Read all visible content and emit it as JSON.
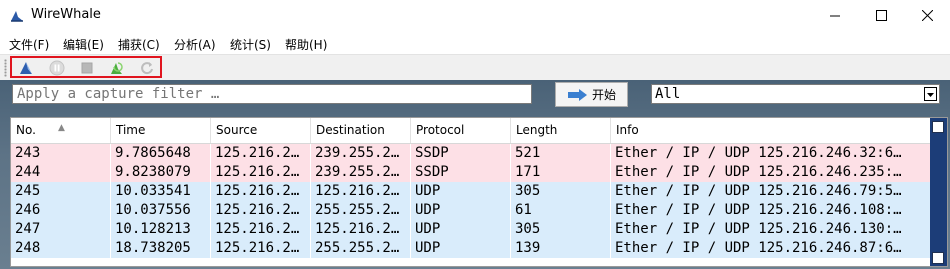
{
  "window": {
    "title": "WireWhale"
  },
  "menu": [
    "文件(F)",
    "编辑(E)",
    "捕获(C)",
    "分析(A)",
    "统计(S)",
    "帮助(H)"
  ],
  "filter": {
    "placeholder": "Apply a capture filter …"
  },
  "start_button": {
    "label": "开始"
  },
  "protocol_select": {
    "value": "All"
  },
  "table": {
    "columns": [
      "No.",
      "Time",
      "Source",
      "Destination",
      "Protocol",
      "Length",
      "Info"
    ],
    "rows": [
      {
        "no": "243",
        "time": "9.7865648",
        "source": "125.216.2…",
        "destination": "239.255.2…",
        "protocol": "SSDP",
        "length": "521",
        "info": "Ether / IP / UDP 125.216.246.32:6…",
        "bg": "#fde0e6"
      },
      {
        "no": "244",
        "time": "9.8238079",
        "source": "125.216.2…",
        "destination": "239.255.2…",
        "protocol": "SSDP",
        "length": "171",
        "info": "Ether / IP / UDP 125.216.246.235:…",
        "bg": "#fde0e6"
      },
      {
        "no": "245",
        "time": "10.033541",
        "source": "125.216.2…",
        "destination": "125.216.2…",
        "protocol": "UDP",
        "length": "305",
        "info": "Ether / IP / UDP 125.216.246.79:5…",
        "bg": "#d9ecfb"
      },
      {
        "no": "246",
        "time": "10.037556",
        "source": "125.216.2…",
        "destination": "255.255.2…",
        "protocol": "UDP",
        "length": "61",
        "info": "Ether / IP / UDP 125.216.246.108:…",
        "bg": "#d9ecfb"
      },
      {
        "no": "247",
        "time": "10.128213",
        "source": "125.216.2…",
        "destination": "125.216.2…",
        "protocol": "UDP",
        "length": "305",
        "info": "Ether / IP / UDP 125.216.246.130:…",
        "bg": "#d9ecfb"
      },
      {
        "no": "248",
        "time": "18.738205",
        "source": "125.216.2…",
        "destination": "255.255.2…",
        "protocol": "UDP",
        "length": "139",
        "info": "Ether / IP / UDP 125.216.246.87:6…",
        "bg": "#d9ecfb"
      }
    ]
  },
  "icons": {
    "app": "shark-fin-icon",
    "toolbar": [
      "start-capture-icon",
      "pause-capture-icon",
      "stop-capture-icon",
      "reopen-capture-icon",
      "restart-capture-icon"
    ],
    "start_button": "arrow-right-icon"
  },
  "colors": {
    "highlight_box": "#e0141e",
    "udp_row": "#d9ecfb",
    "ssdp_row": "#fde0e6",
    "scrollbar": "#1c3d78"
  }
}
